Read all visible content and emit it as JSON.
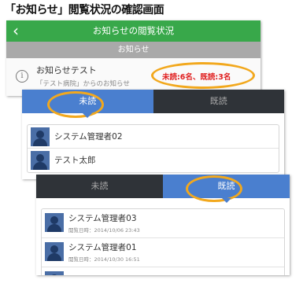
{
  "caption": "「お知らせ」閲覧状況の確認画面",
  "panel1": {
    "back_icon": "chevron-left-icon",
    "title": "お知らせの閲覧状況",
    "section": "お知らせ",
    "notice": {
      "icon": "info-icon",
      "title": "お知らせテスト",
      "from": "「テスト病院」からのお知らせ",
      "counts": "未読:6名、既読:3名"
    }
  },
  "panel2": {
    "tab_unread": "未読",
    "tab_read": "既読",
    "items": [
      {
        "name": "システム管理者02"
      },
      {
        "name": "テスト太郎"
      }
    ]
  },
  "panel3": {
    "tab_unread": "未読",
    "tab_read": "既読",
    "items": [
      {
        "name": "システム管理者03",
        "date": "閲覧日時：2014/10/06 23:43"
      },
      {
        "name": "システム管理者01",
        "date": "閲覧日時：2014/10/30 16:51"
      }
    ]
  },
  "colors": {
    "header_green": "#38a84a",
    "tab_blue": "#4a7fcf",
    "tab_dark": "#2f3338",
    "highlight_orange": "#f2a81d",
    "count_red": "#e02020"
  }
}
